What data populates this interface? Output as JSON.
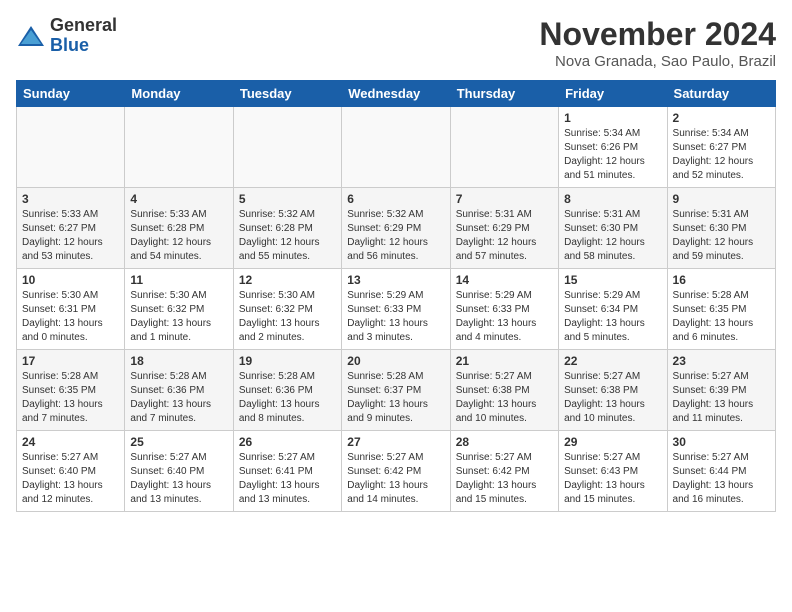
{
  "logo": {
    "line1": "General",
    "line2": "Blue"
  },
  "title": "November 2024",
  "location": "Nova Granada, Sao Paulo, Brazil",
  "days_of_week": [
    "Sunday",
    "Monday",
    "Tuesday",
    "Wednesday",
    "Thursday",
    "Friday",
    "Saturday"
  ],
  "weeks": [
    [
      {
        "day": "",
        "info": ""
      },
      {
        "day": "",
        "info": ""
      },
      {
        "day": "",
        "info": ""
      },
      {
        "day": "",
        "info": ""
      },
      {
        "day": "",
        "info": ""
      },
      {
        "day": "1",
        "info": "Sunrise: 5:34 AM\nSunset: 6:26 PM\nDaylight: 12 hours and 51 minutes."
      },
      {
        "day": "2",
        "info": "Sunrise: 5:34 AM\nSunset: 6:27 PM\nDaylight: 12 hours and 52 minutes."
      }
    ],
    [
      {
        "day": "3",
        "info": "Sunrise: 5:33 AM\nSunset: 6:27 PM\nDaylight: 12 hours and 53 minutes."
      },
      {
        "day": "4",
        "info": "Sunrise: 5:33 AM\nSunset: 6:28 PM\nDaylight: 12 hours and 54 minutes."
      },
      {
        "day": "5",
        "info": "Sunrise: 5:32 AM\nSunset: 6:28 PM\nDaylight: 12 hours and 55 minutes."
      },
      {
        "day": "6",
        "info": "Sunrise: 5:32 AM\nSunset: 6:29 PM\nDaylight: 12 hours and 56 minutes."
      },
      {
        "day": "7",
        "info": "Sunrise: 5:31 AM\nSunset: 6:29 PM\nDaylight: 12 hours and 57 minutes."
      },
      {
        "day": "8",
        "info": "Sunrise: 5:31 AM\nSunset: 6:30 PM\nDaylight: 12 hours and 58 minutes."
      },
      {
        "day": "9",
        "info": "Sunrise: 5:31 AM\nSunset: 6:30 PM\nDaylight: 12 hours and 59 minutes."
      }
    ],
    [
      {
        "day": "10",
        "info": "Sunrise: 5:30 AM\nSunset: 6:31 PM\nDaylight: 13 hours and 0 minutes."
      },
      {
        "day": "11",
        "info": "Sunrise: 5:30 AM\nSunset: 6:32 PM\nDaylight: 13 hours and 1 minute."
      },
      {
        "day": "12",
        "info": "Sunrise: 5:30 AM\nSunset: 6:32 PM\nDaylight: 13 hours and 2 minutes."
      },
      {
        "day": "13",
        "info": "Sunrise: 5:29 AM\nSunset: 6:33 PM\nDaylight: 13 hours and 3 minutes."
      },
      {
        "day": "14",
        "info": "Sunrise: 5:29 AM\nSunset: 6:33 PM\nDaylight: 13 hours and 4 minutes."
      },
      {
        "day": "15",
        "info": "Sunrise: 5:29 AM\nSunset: 6:34 PM\nDaylight: 13 hours and 5 minutes."
      },
      {
        "day": "16",
        "info": "Sunrise: 5:28 AM\nSunset: 6:35 PM\nDaylight: 13 hours and 6 minutes."
      }
    ],
    [
      {
        "day": "17",
        "info": "Sunrise: 5:28 AM\nSunset: 6:35 PM\nDaylight: 13 hours and 7 minutes."
      },
      {
        "day": "18",
        "info": "Sunrise: 5:28 AM\nSunset: 6:36 PM\nDaylight: 13 hours and 7 minutes."
      },
      {
        "day": "19",
        "info": "Sunrise: 5:28 AM\nSunset: 6:36 PM\nDaylight: 13 hours and 8 minutes."
      },
      {
        "day": "20",
        "info": "Sunrise: 5:28 AM\nSunset: 6:37 PM\nDaylight: 13 hours and 9 minutes."
      },
      {
        "day": "21",
        "info": "Sunrise: 5:27 AM\nSunset: 6:38 PM\nDaylight: 13 hours and 10 minutes."
      },
      {
        "day": "22",
        "info": "Sunrise: 5:27 AM\nSunset: 6:38 PM\nDaylight: 13 hours and 10 minutes."
      },
      {
        "day": "23",
        "info": "Sunrise: 5:27 AM\nSunset: 6:39 PM\nDaylight: 13 hours and 11 minutes."
      }
    ],
    [
      {
        "day": "24",
        "info": "Sunrise: 5:27 AM\nSunset: 6:40 PM\nDaylight: 13 hours and 12 minutes."
      },
      {
        "day": "25",
        "info": "Sunrise: 5:27 AM\nSunset: 6:40 PM\nDaylight: 13 hours and 13 minutes."
      },
      {
        "day": "26",
        "info": "Sunrise: 5:27 AM\nSunset: 6:41 PM\nDaylight: 13 hours and 13 minutes."
      },
      {
        "day": "27",
        "info": "Sunrise: 5:27 AM\nSunset: 6:42 PM\nDaylight: 13 hours and 14 minutes."
      },
      {
        "day": "28",
        "info": "Sunrise: 5:27 AM\nSunset: 6:42 PM\nDaylight: 13 hours and 15 minutes."
      },
      {
        "day": "29",
        "info": "Sunrise: 5:27 AM\nSunset: 6:43 PM\nDaylight: 13 hours and 15 minutes."
      },
      {
        "day": "30",
        "info": "Sunrise: 5:27 AM\nSunset: 6:44 PM\nDaylight: 13 hours and 16 minutes."
      }
    ]
  ]
}
